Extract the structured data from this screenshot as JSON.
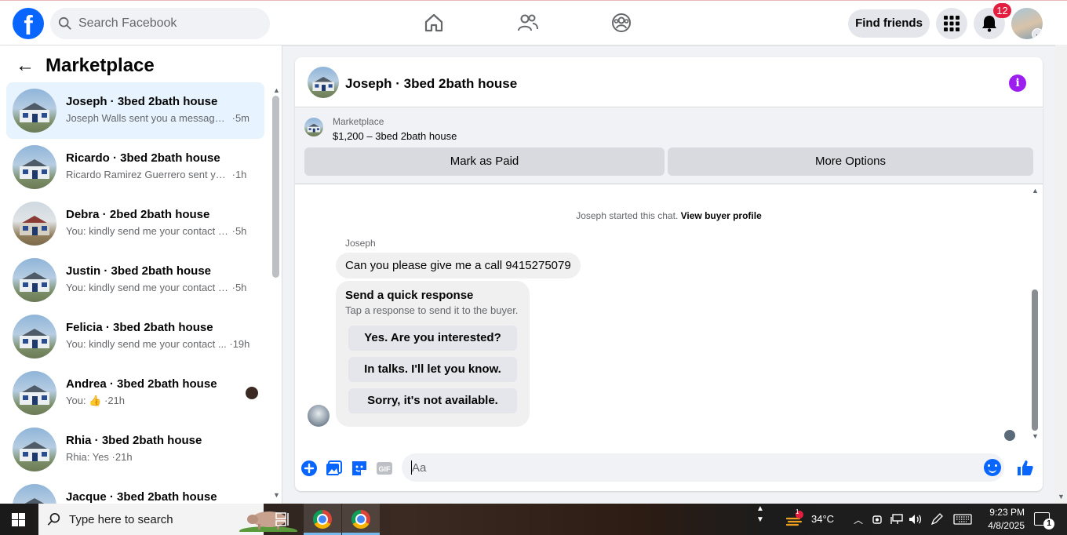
{
  "header": {
    "search_placeholder": "Search Facebook",
    "find_friends": "Find friends",
    "notifications_count": "12"
  },
  "sidebar": {
    "title": "Marketplace",
    "conversations": [
      {
        "title": "Joseph · 3bed 2bath house",
        "snippet": "Joseph Walls sent you a message a...",
        "time": "5m",
        "active": true
      },
      {
        "title": "Ricardo · 3bed 2bath house",
        "snippet": "Ricardo Ramirez Guerrero sent you ...",
        "time": "1h"
      },
      {
        "title": "Debra · 2bed 2bath house",
        "snippet": "You: kindly send me your contact n...",
        "time": "5h"
      },
      {
        "title": "Justin · 3bed 2bath house",
        "snippet": "You: kindly send me your contact n...",
        "time": "5h"
      },
      {
        "title": "Felicia · 3bed 2bath house",
        "snippet": "You: kindly send me your contact ...",
        "time": "19h"
      },
      {
        "title": "Andrea · 3bed 2bath house",
        "snippet": "You: 👍",
        "time": "21h"
      },
      {
        "title": "Rhia · 3bed 2bath house",
        "snippet": "Rhia: Yes",
        "time": "21h"
      },
      {
        "title": "Jacque · 3bed 2bath house",
        "snippet": "",
        "time": ""
      }
    ]
  },
  "chat": {
    "title": "Joseph · 3bed 2bath house",
    "listing_label": "Marketplace",
    "listing_price": "$1,200 – 3bed 2bath house",
    "mark_paid": "Mark as Paid",
    "more_options": "More Options",
    "started_text": "Joseph started this chat.",
    "view_profile": "View buyer profile",
    "sender": "Joseph",
    "message": "Can you please give me a call 9415275079",
    "quick_title": "Send a quick response",
    "quick_sub": "Tap a response to send it to the buyer.",
    "quick_options": [
      "Yes. Are you interested?",
      "In talks. I'll let you know.",
      "Sorry, it's not available."
    ],
    "composer_placeholder": "Aa"
  },
  "taskbar": {
    "search_placeholder": "Type here to search",
    "weather": "34°C",
    "time": "9:23 PM",
    "date": "4/8/2025",
    "weather_badge": "1",
    "notif_count": "1"
  },
  "colors": {
    "brand": "#0866ff",
    "info": "#9c1ff0",
    "badge": "#e41e3f"
  }
}
